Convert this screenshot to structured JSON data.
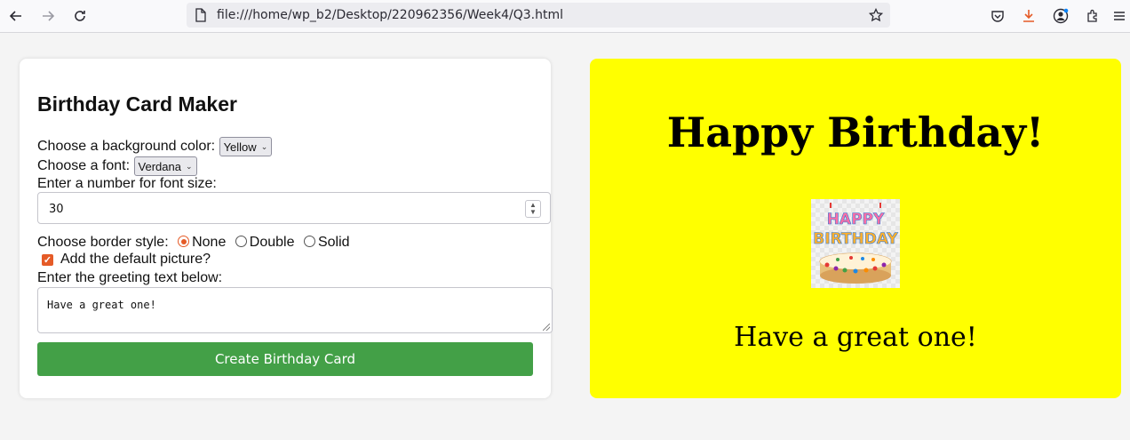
{
  "browser": {
    "url": "file:///home/wp_b2/Desktop/220962356/Week4/Q3.html"
  },
  "form": {
    "title": "Birthday Card Maker",
    "bg_color_label": "Choose a background color:",
    "bg_color_value": "Yellow",
    "font_label": "Choose a font:",
    "font_value": "Verdana",
    "font_size_label": "Enter a number for font size:",
    "font_size_value": "30",
    "border_label": "Choose border style:",
    "border_options": [
      "None",
      "Double",
      "Solid"
    ],
    "border_selected": "None",
    "picture_label": "Add the default picture?",
    "picture_checked": true,
    "greeting_label": "Enter the greeting text below:",
    "greeting_value": "Have a great one!",
    "create_button": "Create Birthday Card"
  },
  "card": {
    "heading": "Happy Birthday!",
    "message": "Have a great one!",
    "background_color": "#ffff00",
    "image_name": "birthday-cake-image"
  },
  "colors": {
    "accent": "#e55b27",
    "button": "#43a047"
  }
}
